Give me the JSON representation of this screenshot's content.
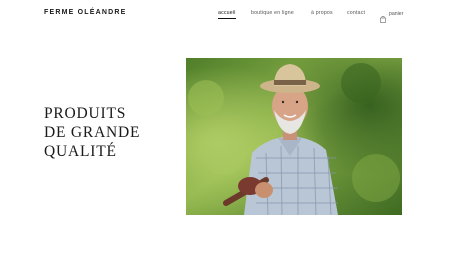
{
  "header": {
    "brand": "FERME OLÉANDRE",
    "nav": [
      {
        "label": "accueil",
        "active": true
      },
      {
        "label": "boutique en ligne",
        "active": false
      },
      {
        "label": "à propos",
        "active": false
      },
      {
        "label": "contact",
        "active": false
      }
    ],
    "cart_label": "panier",
    "cart_icon": "shopping-bag-icon"
  },
  "hero": {
    "title_lines": [
      "PRODUITS",
      "DE GRANDE",
      "QUALITÉ"
    ]
  },
  "colors": {
    "text": "#1a1a1a",
    "nav_text": "#555555",
    "background": "#ffffff"
  }
}
